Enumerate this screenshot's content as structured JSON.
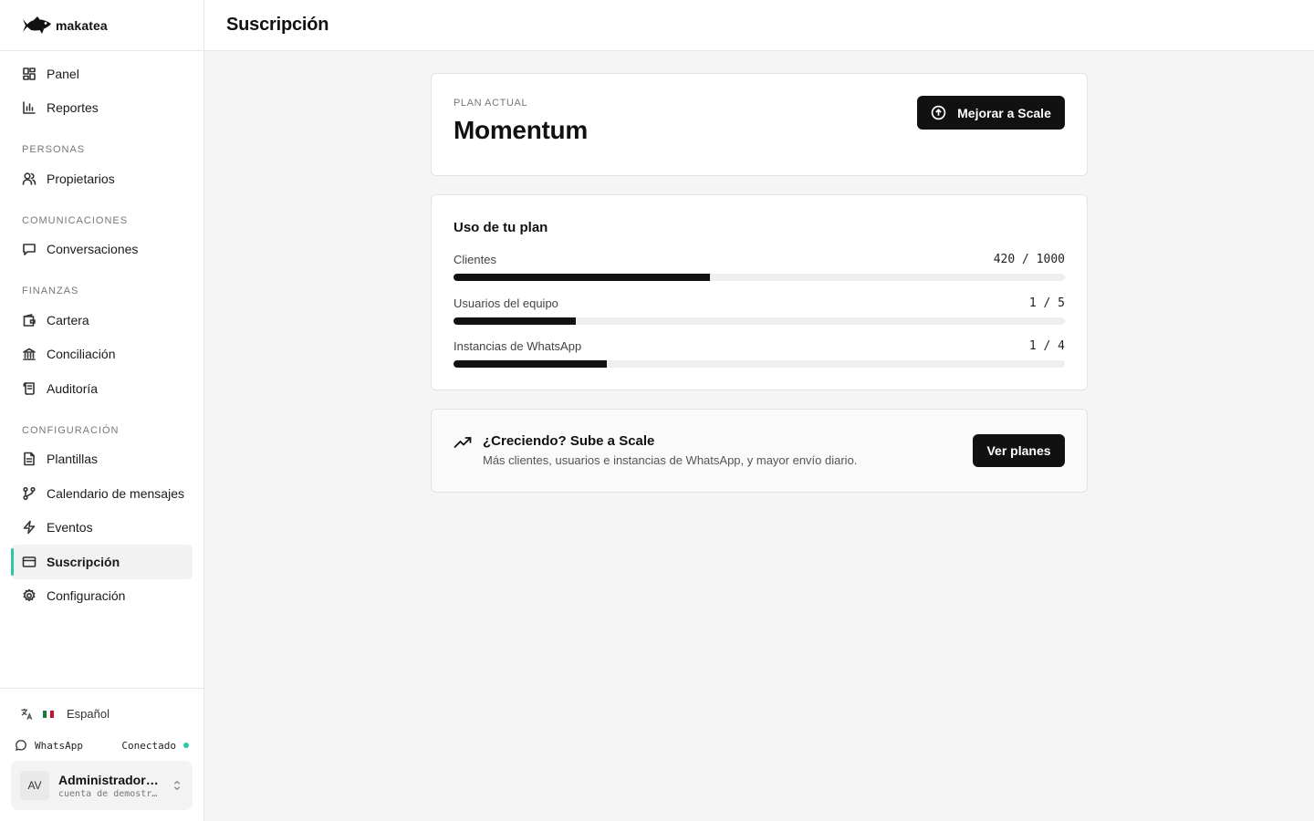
{
  "brand": {
    "name": "makatea"
  },
  "page": {
    "title": "Suscripción"
  },
  "sidebar": {
    "top_items": [
      {
        "label": "Panel",
        "icon": "dashboard-icon"
      },
      {
        "label": "Reportes",
        "icon": "bar-chart-icon"
      }
    ],
    "sections": [
      {
        "label": "PERSONAS",
        "items": [
          {
            "label": "Propietarios",
            "icon": "users-icon"
          }
        ]
      },
      {
        "label": "COMUNICACIONES",
        "items": [
          {
            "label": "Conversaciones",
            "icon": "message-icon"
          }
        ]
      },
      {
        "label": "FINANZAS",
        "items": [
          {
            "label": "Cartera",
            "icon": "wallet-icon"
          },
          {
            "label": "Conciliación",
            "icon": "bank-icon"
          },
          {
            "label": "Auditoría",
            "icon": "scroll-icon"
          }
        ]
      },
      {
        "label": "CONFIGURACIÓN",
        "items": [
          {
            "label": "Plantillas",
            "icon": "file-text-icon"
          },
          {
            "label": "Calendario de mensajes",
            "icon": "git-branch-icon"
          },
          {
            "label": "Eventos",
            "icon": "zap-icon"
          },
          {
            "label": "Suscripción",
            "icon": "credit-card-icon",
            "active": true
          },
          {
            "label": "Configuración",
            "icon": "gear-icon"
          }
        ]
      }
    ],
    "footer": {
      "language": "Español",
      "whatsapp_label": "WhatsApp",
      "whatsapp_status": "Conectado",
      "user_initials": "AV",
      "user_name": "Administradora ...",
      "user_account": "cuenta de demostr…"
    }
  },
  "plan": {
    "label": "PLAN ACTUAL",
    "name": "Momentum",
    "upgrade_button": "Mejorar a Scale"
  },
  "usage": {
    "title": "Uso de tu plan",
    "rows": [
      {
        "label": "Clientes",
        "count": "420 / 1000",
        "fraction": 0.42
      },
      {
        "label": "Usuarios del equipo",
        "count": "1 / 5",
        "fraction": 0.2
      },
      {
        "label": "Instancias de WhatsApp",
        "count": "1 / 4",
        "fraction": 0.25
      }
    ]
  },
  "upsell": {
    "title": "¿Creciendo? Sube a Scale",
    "description": "Más clientes, usuarios e instancias de WhatsApp, y mayor envío diario.",
    "button": "Ver planes"
  },
  "colors": {
    "accent": "#2fc6a4",
    "primary_button": "#111111"
  }
}
